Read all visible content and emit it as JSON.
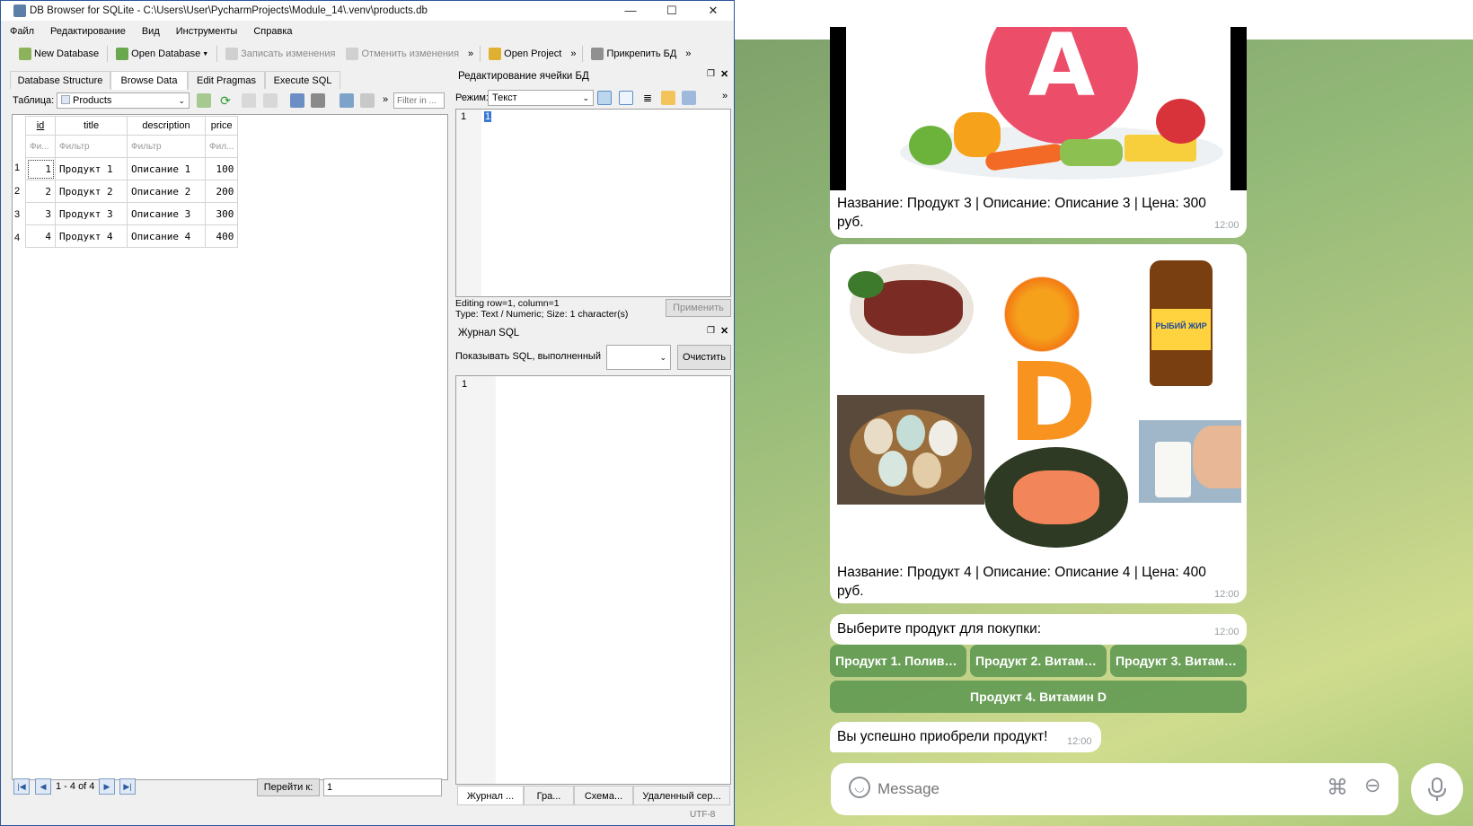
{
  "window": {
    "title": "DB Browser for SQLite - C:\\Users\\User\\PycharmProjects\\Module_14\\.venv\\products.db",
    "minimize": "—",
    "maximize": "☐",
    "close": "✕"
  },
  "menu": [
    "Файл",
    "Редактирование",
    "Вид",
    "Инструменты",
    "Справка"
  ],
  "toolbar": {
    "new_db": "New Database",
    "open_db": "Open Database",
    "write_changes": "Записать изменения",
    "revert_changes": "Отменить изменения",
    "open_project": "Open Project",
    "attach_db": "Прикрепить БД",
    "more": "»"
  },
  "tabs": [
    "Database Structure",
    "Browse Data",
    "Edit Pragmas",
    "Execute SQL"
  ],
  "browse": {
    "table_label": "Таблица:",
    "table_value": "Products",
    "filter_placeholder": "Filter in ...",
    "columns": [
      "id",
      "title",
      "description",
      "price"
    ],
    "filters": [
      "Фи...",
      "Фильтр",
      "Фильтр",
      "Фил..."
    ],
    "rows": [
      [
        "1",
        "Продукт 1",
        "Описание 1",
        "100"
      ],
      [
        "2",
        "Продукт 2",
        "Описание 2",
        "200"
      ],
      [
        "3",
        "Продукт 3",
        "Описание 3",
        "300"
      ],
      [
        "4",
        "Продукт 4",
        "Описание 4",
        "400"
      ]
    ],
    "row_numbers": [
      "1",
      "2",
      "3",
      "4"
    ],
    "pager_text": "1 - 4 of 4",
    "goto_label": "Перейти к:",
    "goto_value": "1"
  },
  "edit_cell": {
    "title": "Редактирование ячейки БД",
    "mode_label": "Режим:",
    "mode_value": "Текст",
    "line_no": "1",
    "cell_value": "1",
    "status_line1": "Editing row=1, column=1",
    "status_line2": "Type: Text / Numeric; Size: 1 character(s)",
    "apply_button": "Применить"
  },
  "sql_log": {
    "title": "Журнал SQL",
    "show_label": "Показывать SQL, выполненный",
    "clear_button": "Очистить",
    "line_no": "1",
    "bottom_tabs": [
      "Журнал ...",
      "Гра...",
      "Схема...",
      "Удаленный сер..."
    ]
  },
  "statusbar": {
    "encoding": "UTF-8"
  },
  "telegram": {
    "messages": [
      {
        "caption_line1": "Название: Продукт 3 | Описание: Описание 3 | Цена: 300",
        "caption_line2": "руб.",
        "time": "12:00",
        "image_letter": "A"
      },
      {
        "caption_line1": "Название: Продукт 4 | Описание: Описание 4 | Цена: 400",
        "caption_line2": "руб.",
        "time": "12:00",
        "image_letter": "D",
        "bottle_label": "РЫБИЙ ЖИР"
      },
      {
        "text": "Выберите продукт для покупки:",
        "time": "12:00"
      },
      {
        "text": "Вы успешно приобрели продукт!",
        "time": "12:00"
      }
    ],
    "keyboard": [
      "Продукт 1. Поливи...",
      "Продукт 2. Витами...",
      "Продукт 3. Витами...",
      "Продукт 4. Витамин D"
    ],
    "input_placeholder": "Message"
  }
}
